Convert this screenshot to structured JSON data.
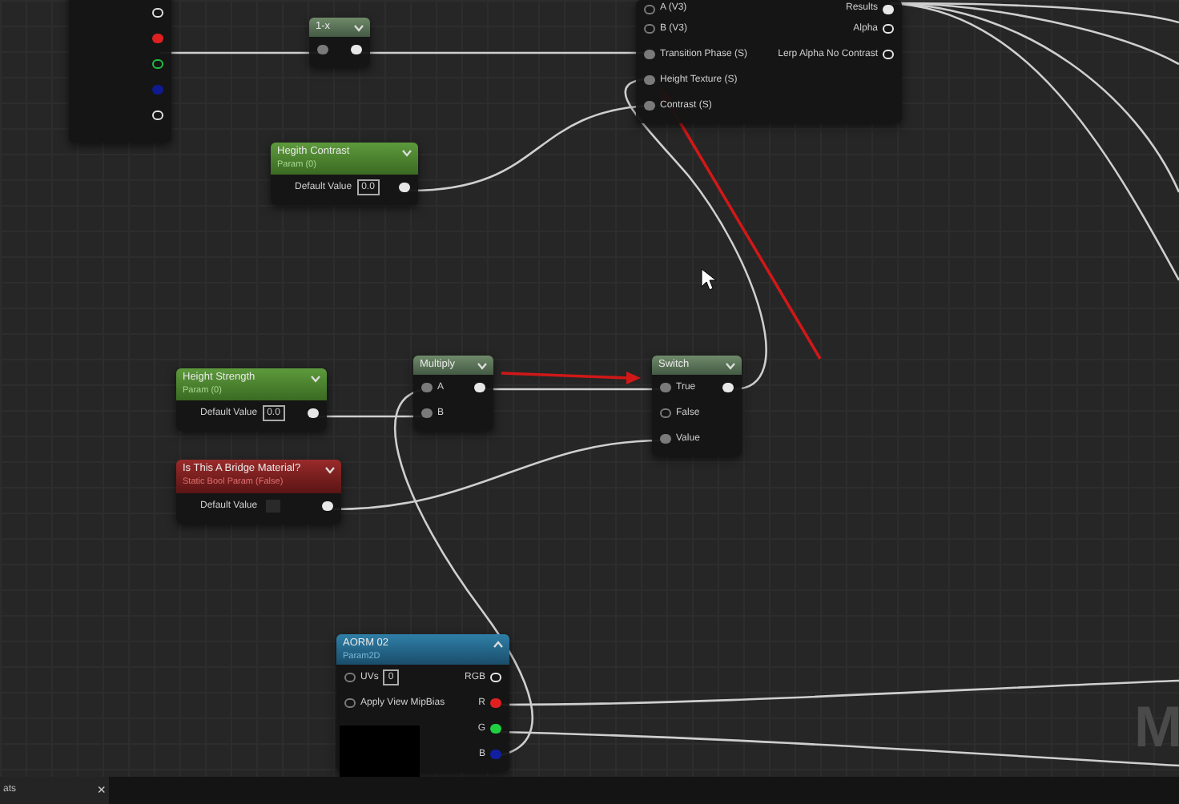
{
  "graph": {
    "nodes": [
      {
        "kind": "partial",
        "rows": [
          {
            "output_connected": false,
            "color": "#e0e0e0"
          },
          {
            "output_connected": true,
            "color": "#e02020"
          },
          {
            "output_connected": false,
            "color": "#20c040"
          },
          {
            "output_connected": true,
            "color": "#101a90"
          },
          {
            "output_connected": false,
            "color": "#e0e0e0"
          }
        ]
      },
      {
        "kind": "math",
        "title": "1-x",
        "rows": [
          {
            "input_connected": true,
            "output_connected": true
          }
        ]
      },
      {
        "kind": "function",
        "rows": [
          {
            "input": "A (V3)",
            "input_connected": false,
            "output": "Results",
            "output_connected": true
          },
          {
            "input": "B (V3)",
            "input_connected": false,
            "output": "Alpha",
            "output_connected": false
          },
          {
            "input": "Transition Phase (S)",
            "input_connected": true,
            "output": "Lerp Alpha No Contrast",
            "output_connected": false
          },
          {
            "input": "Height Texture (S)",
            "input_connected": true
          },
          {
            "input": "Contrast (S)",
            "input_connected": true
          }
        ]
      },
      {
        "kind": "scalar_param",
        "title": "Hegith Contrast",
        "subtitle": "Param (0)",
        "rows": [
          {
            "label": "Default Value",
            "value": "0.0",
            "output_connected": true
          }
        ]
      },
      {
        "kind": "scalar_param",
        "title": "Height Strength",
        "subtitle": "Param (0)",
        "rows": [
          {
            "label": "Default Value",
            "value": "0.0",
            "output_connected": true
          }
        ]
      },
      {
        "kind": "math",
        "title": "Multiply",
        "rows": [
          {
            "input": "A",
            "input_connected": true,
            "output_connected": true
          },
          {
            "input": "B",
            "input_connected": true
          }
        ]
      },
      {
        "kind": "math",
        "title": "Switch",
        "rows": [
          {
            "input": "True",
            "input_connected": true,
            "output_connected": true
          },
          {
            "input": "False",
            "input_connected": false
          },
          {
            "input": "Value",
            "input_connected": true
          }
        ]
      },
      {
        "kind": "bool_param",
        "title": "Is This A Bridge Material?",
        "subtitle": "Static Bool Param (False)",
        "rows": [
          {
            "label": "Default Value",
            "checked": false,
            "output_connected": true
          }
        ]
      },
      {
        "kind": "texture_param",
        "title": "AORM 02",
        "subtitle": "Param2D",
        "expanded": true,
        "rows": [
          {
            "input": "UVs",
            "value": "0",
            "input_connected": false,
            "output": "RGB",
            "output_connected": false
          },
          {
            "input": "Apply View MipBias",
            "input_connected": false,
            "output": "R",
            "output_connected": true,
            "color": "#e02020"
          },
          {
            "output": "G",
            "output_connected": true,
            "color": "#20d040"
          },
          {
            "output": "B",
            "output_connected": true,
            "color": "#1020a0"
          }
        ]
      }
    ],
    "graph_label": "M"
  },
  "bottom_tab": {
    "label": "ats",
    "close": "×"
  }
}
